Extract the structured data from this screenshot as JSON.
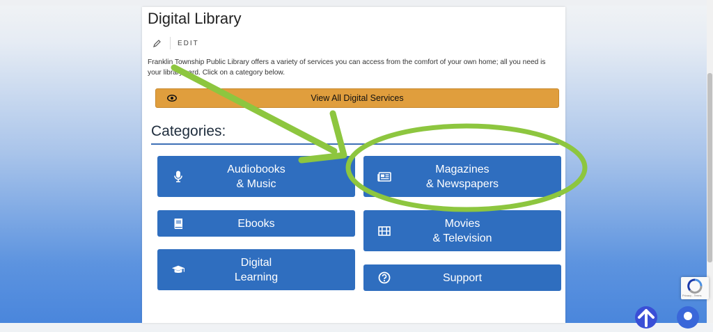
{
  "page": {
    "title": "Digital Library",
    "edit_label": "EDIT",
    "intro": "Franklin Township Public Library offers a variety of services you can access from the comfort of your own home; all you need is your library card. Click on a category below.",
    "view_all_label": "View All Digital Services",
    "categories_heading": "Categories:"
  },
  "categories": [
    {
      "label": "Audiobooks\n& Music",
      "icon": "microphone-icon"
    },
    {
      "label": "Magazines\n& Newspapers",
      "icon": "newspaper-icon"
    },
    {
      "label": "Ebooks",
      "icon": "book-icon"
    },
    {
      "label": "Movies\n& Television",
      "icon": "film-icon"
    },
    {
      "label": "Digital\nLearning",
      "icon": "graduation-cap-icon"
    },
    {
      "label": "Support",
      "icon": "question-circle-icon"
    }
  ],
  "recaptcha": {
    "terms": "Privacy - Terms"
  },
  "colors": {
    "button_blue": "#2f6ebf",
    "view_all_orange": "#e09e3d",
    "annotation_green": "#8dc63f"
  }
}
